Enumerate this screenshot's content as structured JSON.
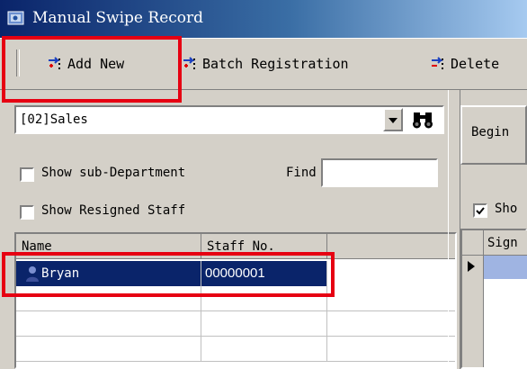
{
  "window": {
    "title": "Manual Swipe Record"
  },
  "toolbar": {
    "add_new": "Add New",
    "batch_registration": "Batch Registration",
    "delete": "Delete"
  },
  "left_panel": {
    "department_value": "[02]Sales",
    "show_sub_department_label": "Show sub-Department",
    "show_sub_department_checked": false,
    "find_label": "Find",
    "find_value": "",
    "show_resigned_label": "Show Resigned Staff",
    "show_resigned_checked": false
  },
  "staff_grid": {
    "columns": [
      "Name",
      "Staff No."
    ],
    "rows": [
      {
        "name": "Bryan",
        "staff_no": "00000001",
        "selected": true
      }
    ]
  },
  "right_panel": {
    "begin_label": "Begin",
    "show_label": "Sho",
    "show_checked": true,
    "grid_header": "Sign"
  },
  "colors": {
    "highlight": "#e60012",
    "selection": "#0a246a",
    "face": "#d4d0c8",
    "record_selected": "#9fb4e2"
  }
}
